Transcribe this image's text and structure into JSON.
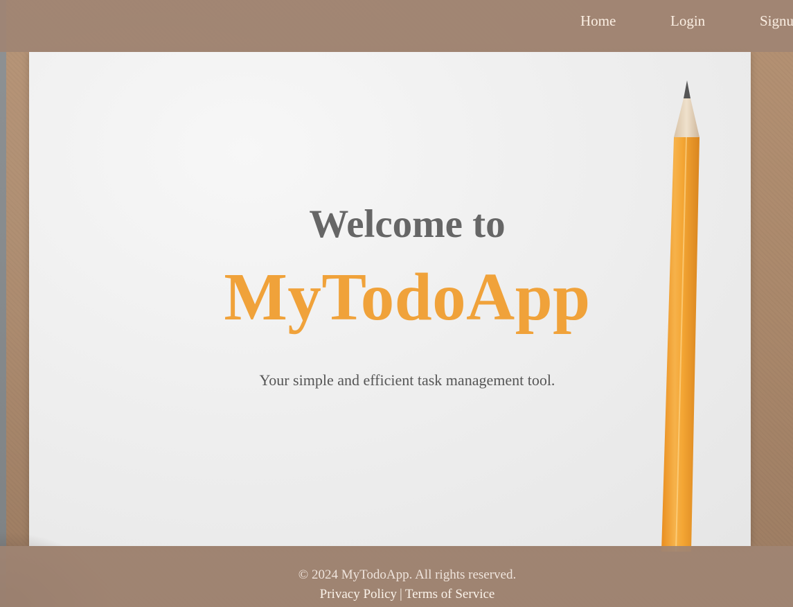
{
  "nav": {
    "home": "Home",
    "login": "Login",
    "signup": "Signup"
  },
  "hero": {
    "welcome": "Welcome to",
    "title": "MyTodoApp",
    "tagline": "Your simple and efficient task management tool."
  },
  "footer": {
    "copyright": "© 2024 MyTodoApp. All rights reserved.",
    "privacy": "Privacy Policy",
    "separator": "|",
    "terms": "Terms of Service"
  },
  "colors": {
    "accent": "#f0a23a",
    "header_bg": "#a08473",
    "heading_gray": "#666666"
  },
  "icons": {
    "background": "pencil-on-paper-image"
  }
}
